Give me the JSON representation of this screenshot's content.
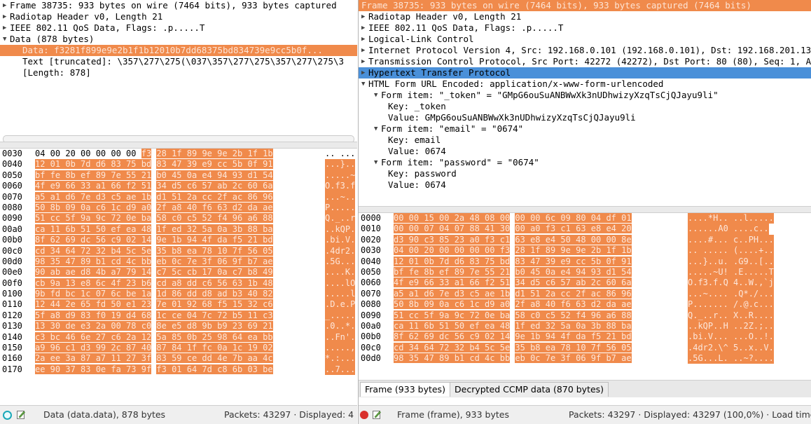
{
  "colors": {
    "selection_orange": "#f08a4b",
    "selection_blue": "#4a90d9",
    "expert_ok": "#1aa8b8",
    "expert_err": "#d9302c"
  },
  "left": {
    "tree": [
      {
        "text": "Frame 38735: 933 bytes on wire (7464 bits), 933 bytes captured",
        "arrow": "right",
        "indent": 0,
        "sel": ""
      },
      {
        "text": "Radiotap Header v0, Length 21",
        "arrow": "right",
        "indent": 0,
        "sel": ""
      },
      {
        "text": "IEEE 802.11 QoS Data, Flags: .p.....T",
        "arrow": "right",
        "indent": 0,
        "sel": ""
      },
      {
        "text": "Data (878 bytes)",
        "arrow": "down",
        "indent": 0,
        "sel": ""
      },
      {
        "text": "Data: f3281f899e9e2b1f1b12010b7dd68375bd834739e9cc5b0f...",
        "arrow": "",
        "indent": 1,
        "sel": "orange"
      },
      {
        "text": "Text [truncated]: \\357\\277\\275(\\037\\357\\277\\275\\357\\277\\275\\3",
        "arrow": "",
        "indent": 1,
        "sel": ""
      },
      {
        "text": "[Length: 878]",
        "arrow": "",
        "indent": 1,
        "sel": ""
      }
    ],
    "hex": [
      {
        "off": "0030",
        "b1": "04 00 20 00 00 00 00",
        "b1h": "f3",
        "b2": "28 1f 89 9e 9e 2b 1f 1b",
        "ascii": ".. ...",
        "hl": "partial"
      },
      {
        "off": "0040",
        "b1": "12 01 0b 7d d6 83 75 bd",
        "b2": "83 47 39 e9 cc 5b 0f 91",
        "ascii": "...}..",
        "hl": "full"
      },
      {
        "off": "0050",
        "b1": "bf fe 8b ef 89 7e 55 21",
        "b2": "b0 45 0a e4 94 93 d1 54",
        "ascii": ".....~",
        "hl": "full"
      },
      {
        "off": "0060",
        "b1": "4f e9 66 33 a1 66 f2 51",
        "b2": "34 d5 c6 57 ab 2c 60 6a",
        "ascii": "O.f3.f",
        "hl": "full"
      },
      {
        "off": "0070",
        "b1": "a5 a1 d6 7e d3 c5 ae 1b",
        "b2": "d1 51 2a cc 2f ac 86 96",
        "ascii": "...~..",
        "hl": "full"
      },
      {
        "off": "0080",
        "b1": "50 8b 09 0a c6 1c d9 a0",
        "b2": "2f a8 40 f6 63 d2 da ae",
        "ascii": "P.....",
        "hl": "full"
      },
      {
        "off": "0090",
        "b1": "51 cc 5f 9a 9c 72 0e ba",
        "b2": "58 c0 c5 52 f4 96 a6 88",
        "ascii": "Q._..r",
        "hl": "full"
      },
      {
        "off": "00a0",
        "b1": "ca 11 6b 51 50 ef ea 48",
        "b2": "1f ed 32 5a 0a 3b 88 ba",
        "ascii": "..kQP.",
        "hl": "full"
      },
      {
        "off": "00b0",
        "b1": "8f 62 69 dc 56 c9 02 14",
        "b2": "9e 1b 94 4f da f5 21 bd",
        "ascii": ".bi.V.",
        "hl": "full"
      },
      {
        "off": "00c0",
        "b1": "cd 34 64 72 32 b4 5c 5e",
        "b2": "35 b8 ea 78 10 7f 56 05",
        "ascii": ".4dr2.",
        "hl": "full"
      },
      {
        "off": "00d0",
        "b1": "98 35 47 89 b1 cd 4c bb",
        "b2": "eb 0c 7e 3f 06 9f b7 ae",
        "ascii": ".5G...",
        "hl": "full"
      },
      {
        "off": "00e0",
        "b1": "90 ab ae d8 4b a7 79 14",
        "b2": "c7 5c cb 17 0a c7 b8 49",
        "ascii": "....K.",
        "hl": "full"
      },
      {
        "off": "00f0",
        "b1": "cb 9a 13 e8 6c 4f 23 b6",
        "b2": "cd a8 dd c6 56 63 1b 48",
        "ascii": "....lO",
        "hl": "full"
      },
      {
        "off": "0100",
        "b1": "9b fd bc 1c 07 6c be 1a",
        "b2": "1d 86 dd d8 ad b3 40 82",
        "ascii": ".....l",
        "hl": "full"
      },
      {
        "off": "0110",
        "b1": "12 44 2e 65 fd 50 e1 23",
        "b2": "7e 01 92 68 f5 15 32 c6",
        "ascii": ".D.e.P",
        "hl": "full"
      },
      {
        "off": "0120",
        "b1": "5f a8 d9 83 f0 19 d4 68",
        "b2": "1c ce 04 7c 72 b5 11 c3",
        "ascii": "_.....",
        "hl": "full"
      },
      {
        "off": "0130",
        "b1": "13 30 de e3 2a 00 78 c0",
        "b2": "8e e5 d8 9b b9 23 69 21",
        "ascii": ".0..*.",
        "hl": "full"
      },
      {
        "off": "0140",
        "b1": "c3 bc 46 6e 27 c6 2a 12",
        "b2": "5a 85 0b 25 98 64 ea bb",
        "ascii": "..Fn'.",
        "hl": "full"
      },
      {
        "off": "0150",
        "b1": "a9 96 c1 d3 99 2c 87 40",
        "b2": "87 84 1f fc 0a 1c 19 02",
        "ascii": ".....,",
        "hl": "full"
      },
      {
        "off": "0160",
        "b1": "2a ee 3a 87 a7 11 27 3f",
        "b2": "83 59 ce dd 4e 7b aa 4c",
        "ascii": "*.:...",
        "hl": "full"
      },
      {
        "off": "0170",
        "b1": "ee 90 37 83 0e fa 73 9f",
        "b2": "f3 01 64 7d c8 6b 03 be",
        "ascii": "..7...",
        "hl": "full"
      }
    ],
    "status_text": "Data (data.data), 878 bytes",
    "packets_text": "Packets: 43297 · Displayed: 4"
  },
  "right": {
    "tree": [
      {
        "text": "Frame 38735: 933 bytes on wire (7464 bits), 933 bytes captured (7464 bits)",
        "arrow": "",
        "indent": 0,
        "sel": "orange"
      },
      {
        "text": "Radiotap Header v0, Length 21",
        "arrow": "right",
        "indent": 0,
        "sel": ""
      },
      {
        "text": "IEEE 802.11 QoS Data, Flags: .p.....T",
        "arrow": "right",
        "indent": 0,
        "sel": ""
      },
      {
        "text": "Logical-Link Control",
        "arrow": "right",
        "indent": 0,
        "sel": ""
      },
      {
        "text": "Internet Protocol Version 4, Src: 192.168.0.101 (192.168.0.101), Dst: 192.168.201.13",
        "arrow": "right",
        "indent": 0,
        "sel": ""
      },
      {
        "text": "Transmission Control Protocol, Src Port: 42272 (42272), Dst Port: 80 (80), Seq: 1, A",
        "arrow": "right",
        "indent": 0,
        "sel": ""
      },
      {
        "text": "Hypertext Transfer Protocol",
        "arrow": "right",
        "indent": 0,
        "sel": "blue"
      },
      {
        "text": "HTML Form URL Encoded: application/x-www-form-urlencoded",
        "arrow": "down",
        "indent": 0,
        "sel": ""
      },
      {
        "text": "Form item: \"_token\" = \"GMpG6ouSuANBWwXk3nUDhwizyXzqTsCjQJayu9li\"",
        "arrow": "down",
        "indent": 1,
        "sel": ""
      },
      {
        "text": "Key: _token",
        "arrow": "",
        "indent": 3,
        "sel": ""
      },
      {
        "text": "Value: GMpG6ouSuANBWwXk3nUDhwizyXzqTsCjQJayu9li",
        "arrow": "",
        "indent": 3,
        "sel": ""
      },
      {
        "text": "Form item: \"email\" = \"0674\"",
        "arrow": "down",
        "indent": 1,
        "sel": ""
      },
      {
        "text": "Key: email",
        "arrow": "",
        "indent": 3,
        "sel": ""
      },
      {
        "text": "Value: 0674",
        "arrow": "",
        "indent": 3,
        "sel": ""
      },
      {
        "text": "Form item: \"password\" = \"0674\"",
        "arrow": "down",
        "indent": 1,
        "sel": ""
      },
      {
        "text": "Key: password",
        "arrow": "",
        "indent": 3,
        "sel": ""
      },
      {
        "text": "Value: 0674",
        "arrow": "",
        "indent": 3,
        "sel": ""
      }
    ],
    "hex": [
      {
        "off": "0000",
        "b1": "00 00 15 00 2a 48 08 00",
        "b2": "00 00 6c 09 80 04 df 01",
        "ascii": "....*H.. ..l.....",
        "hl": "full"
      },
      {
        "off": "0010",
        "b1": "00 00 07 04 07 88 41 30",
        "b2": "00 a0 f3 c1 63 e8 e4 20",
        "ascii": "......A0 ....c..",
        "hl": "full"
      },
      {
        "off": "0020",
        "b1": "d3 90 c3 85 23 a0 f3 c1",
        "b2": "63 e8 e4 50 48 00 00 8e",
        "ascii": "....#... c..PH...",
        "hl": "full"
      },
      {
        "off": "0030",
        "b1": "04 00 20 00 00 00 00 f3",
        "b2": "28 1f 89 9e 9e 2b 1f 1b",
        "ascii": ".. ..... (....+..",
        "hl": "full"
      },
      {
        "off": "0040",
        "b1": "12 01 0b 7d d6 83 75 bd",
        "b2": "83 47 39 e9 cc 5b 0f 91",
        "ascii": "...}..u. .G9..[..",
        "hl": "full"
      },
      {
        "off": "0050",
        "b1": "bf fe 8b ef 89 7e 55 21",
        "b2": "b0 45 0a e4 94 93 d1 54",
        "ascii": ".....~U! .E.....T",
        "hl": "full"
      },
      {
        "off": "0060",
        "b1": "4f e9 66 33 a1 66 f2 51",
        "b2": "34 d5 c6 57 ab 2c 60 6a",
        "ascii": "O.f3.f.Q 4..W.,`j",
        "hl": "full"
      },
      {
        "off": "0070",
        "b1": "a5 a1 d6 7e d3 c5 ae 1b",
        "b2": "d1 51 2a cc 2f ac 86 96",
        "ascii": "...~.... .Q*./...",
        "hl": "full"
      },
      {
        "off": "0080",
        "b1": "50 8b 09 0a c6 1c d9 a0",
        "b2": "2f a8 40 f6 63 d2 da ae",
        "ascii": "P....... /.@.c...",
        "hl": "full"
      },
      {
        "off": "0090",
        "b1": "51 cc 5f 9a 9c 72 0e ba",
        "b2": "58 c0 c5 52 f4 96 a6 88",
        "ascii": "Q._..r.. X..R....",
        "hl": "full"
      },
      {
        "off": "00a0",
        "b1": "ca 11 6b 51 50 ef ea 48",
        "b2": "1f ed 32 5a 0a 3b 88 ba",
        "ascii": "..kQP..H ..2Z.;..",
        "hl": "full"
      },
      {
        "off": "00b0",
        "b1": "8f 62 69 dc 56 c9 02 14",
        "b2": "9e 1b 94 4f da f5 21 bd",
        "ascii": ".bi.V... ...O..!.",
        "hl": "full"
      },
      {
        "off": "00c0",
        "b1": "cd 34 64 72 32 b4 5c 5e",
        "b2": "35 b8 ea 78 10 7f 56 05",
        "ascii": ".4dr2.\\^ 5..x..V.",
        "hl": "full"
      },
      {
        "off": "00d0",
        "b1": "98 35 47 89 b1 cd 4c bb",
        "b2": "eb 0c 7e 3f 06 9f b7 ae",
        "ascii": ".5G...L. ..~?....",
        "hl": "full"
      }
    ],
    "tab_frame": "Frame (933 bytes)",
    "tab_decrypted": "Decrypted CCMP data (870 bytes)",
    "status_text": "Frame (frame), 933 bytes",
    "packets_text": "Packets: 43297 · Displayed: 43297 (100,0%) · Load time"
  }
}
